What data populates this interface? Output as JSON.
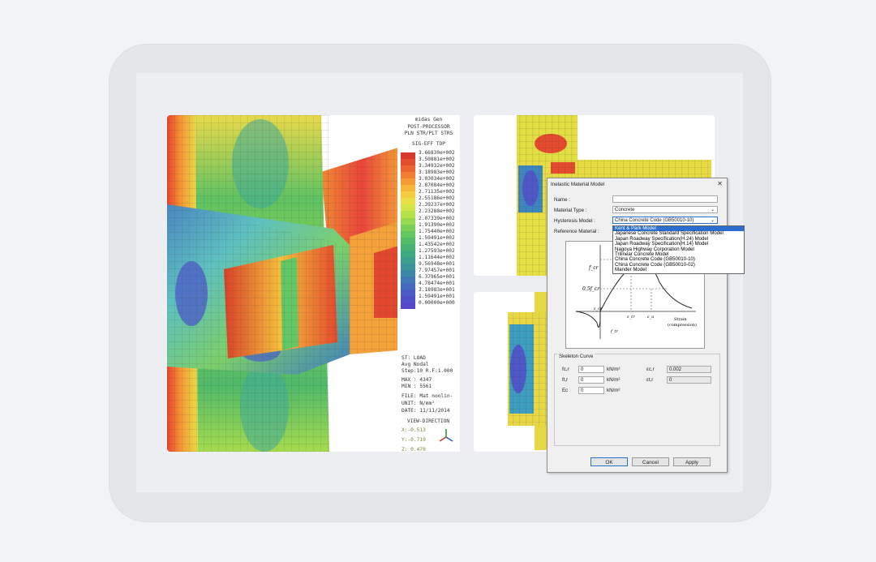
{
  "legend": {
    "header": [
      "midas Gen",
      "POST-PROCESSOR",
      "PLN STR/PLT STRS",
      "SIG-EFF TOP"
    ],
    "values": [
      "3.66830e+002",
      "3.50881e+002",
      "3.34932e+002",
      "3.18983e+002",
      "3.03034e+002",
      "2.87084e+002",
      "2.71135e+002",
      "2.55186e+002",
      "2.39237e+002",
      "2.23288e+002",
      "2.07339e+002",
      "1.91390e+002",
      "1.75440e+002",
      "1.59491e+002",
      "1.43542e+002",
      "1.27593e+002",
      "1.11644e+002",
      "9.56948e+001",
      "7.97457e+001",
      "6.37965e+001",
      "4.78474e+001",
      "3.18983e+001",
      "1.59491e+001",
      "0.00000e+000"
    ],
    "colors": [
      "#d63b2b",
      "#e24e2d",
      "#ec6530",
      "#f27e33",
      "#f59a36",
      "#f6b63a",
      "#f4cd3f",
      "#e9df44",
      "#d3e547",
      "#b6e14b",
      "#97d950",
      "#7bd057",
      "#63c65e",
      "#52bc68",
      "#47b274",
      "#3fa980",
      "#3c9f8e",
      "#3b949c",
      "#3d88aa",
      "#4078b6",
      "#4669be",
      "#4c5cc4",
      "#5150c8",
      "#5646c9"
    ],
    "info": [
      "ST: LOAD",
      "Avg Nodal",
      "Step:10 R.F:1.000",
      "MAX : 4347",
      "MIN : 5561",
      "FILE: Mat nonlin-",
      "UNIT: N/mm²",
      "DATE: 11/11/2014"
    ],
    "view_direction": "VIEW-DIRECTION",
    "coords": [
      "X:-0.513",
      "Y:-0.719",
      "Z: 0.470"
    ]
  },
  "dialog": {
    "title": "Inelastic Material Model",
    "close": "✕",
    "name_label": "Name :",
    "name_value": "",
    "material_type_label": "Material Type :",
    "material_type_value": "Concrete",
    "hysteresis_label": "Hysteresis Model :",
    "hysteresis_value": "China Concrete Code (GB50010-10)",
    "reference_label": "Reference Material :",
    "dropdown_options": [
      "Kent & Park Model",
      "Japanese Concrete Standard Specification Model",
      "Japan Roadway Specification(H.24) Model",
      "Japan Roadway Specification(H.14) Model",
      "Nagoya Highway Corporation Model",
      "Trilinear Concrete Model",
      "China Concrete Code (GB50010-10)",
      "China Concrete Code (GB50010-02)",
      "Mander Model"
    ],
    "chart_labels": {
      "fcr": "f_cr",
      "half_fcr": "0.5f_cr",
      "ecr": "ε_cr",
      "ftr": "f_tr",
      "etr": "ε_tr",
      "eu": "ε_u",
      "strain": "Strain",
      "compression": "(compression)"
    },
    "skeleton_title": "Skeleton Curve",
    "fields": [
      {
        "label": "fc,r",
        "value": "0",
        "unit": "kN/m²"
      },
      {
        "label": "ft,r",
        "value": "0",
        "unit": "kN/m²"
      },
      {
        "label": "Ec",
        "value": "0",
        "unit": "kN/m²"
      }
    ],
    "fields_right": [
      {
        "label": "εc,r",
        "value": "0.002"
      },
      {
        "label": "εt,r",
        "value": "0"
      }
    ],
    "ok": "OK",
    "cancel": "Cancel",
    "apply": "Apply"
  }
}
